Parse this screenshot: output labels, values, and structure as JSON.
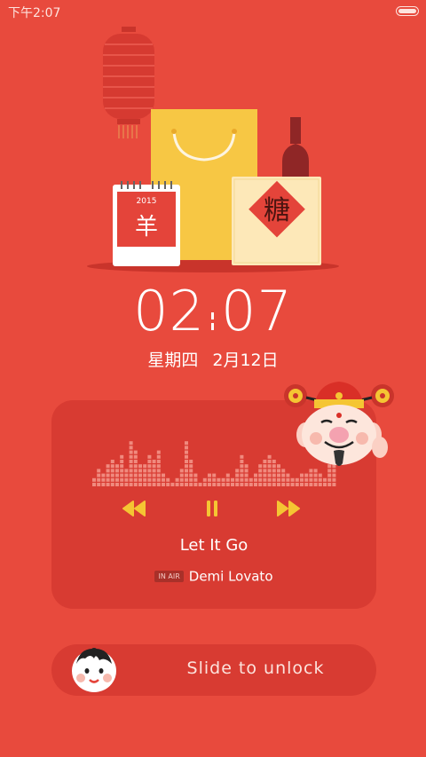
{
  "status_bar": {
    "time": "下午2:07"
  },
  "lockscreen": {
    "clock_hours": "02",
    "clock_minutes": "07",
    "date_weekday": "星期四",
    "date_day": "2月12日",
    "calendar_year": "2015",
    "calendar_char": "羊",
    "gift_char": "糖"
  },
  "music": {
    "title": "Let It Go",
    "badge": "IN AIR",
    "artist": "Demi Lovato",
    "eq_levels": [
      0.22,
      0.35,
      0.25,
      0.48,
      0.55,
      0.42,
      0.62,
      0.38,
      0.85,
      0.7,
      0.5,
      0.45,
      0.6,
      0.52,
      0.68,
      0.3,
      0.2,
      0.12,
      0.18,
      0.35,
      0.92,
      0.55,
      0.28,
      0.15,
      0.22,
      0.3,
      0.25,
      0.18,
      0.2,
      0.28,
      0.2,
      0.35,
      0.6,
      0.42,
      0.22,
      0.28,
      0.5,
      0.58,
      0.62,
      0.55,
      0.45,
      0.35,
      0.28,
      0.22,
      0.18,
      0.25,
      0.3,
      0.4,
      0.38,
      0.25,
      0.2,
      0.5,
      0.62
    ],
    "accent_color": "#f5c533"
  },
  "unlock": {
    "label": "Slide to unlock"
  }
}
